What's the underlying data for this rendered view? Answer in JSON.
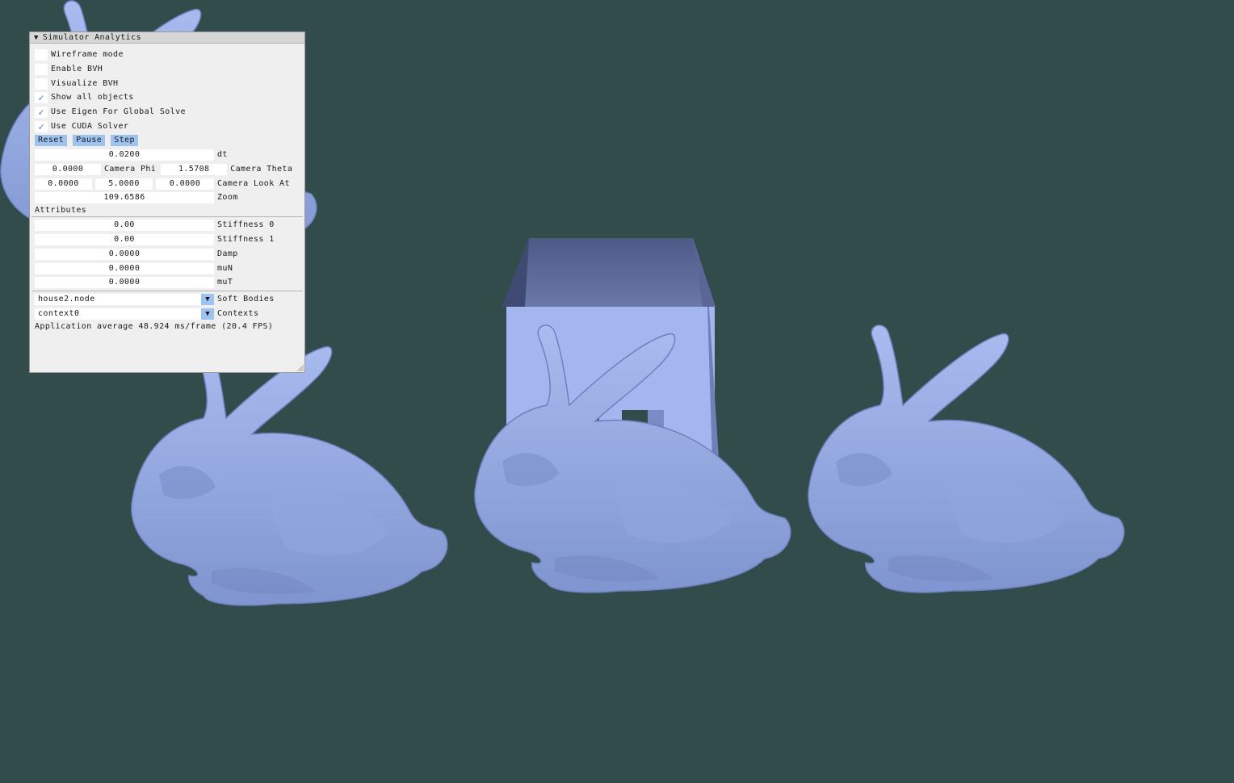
{
  "panel": {
    "title": "Simulator Analytics",
    "collapse_icon": "triangle-down-icon",
    "checkboxes": [
      {
        "label": "Wireframe mode",
        "checked": false
      },
      {
        "label": "Enable BVH",
        "checked": false
      },
      {
        "label": "Visualize BVH",
        "checked": false
      },
      {
        "label": "Show all objects",
        "checked": true
      },
      {
        "label": "Use Eigen For Global Solve",
        "checked": true
      },
      {
        "label": "Use CUDA Solver",
        "checked": true
      }
    ],
    "buttons": {
      "reset": "Reset",
      "pause": "Pause",
      "step": "Step"
    },
    "dt": {
      "value": "0.0200",
      "label": "dt"
    },
    "camera_phi": {
      "value": "0.0000",
      "label": "Camera Phi"
    },
    "camera_theta": {
      "value": "1.5708",
      "label": "Camera Theta"
    },
    "camera_look_at": {
      "x": "0.0000",
      "y": "5.0000",
      "z": "0.0000",
      "label": "Camera Look At"
    },
    "zoom": {
      "value": "109.6586",
      "label": "Zoom"
    },
    "attributes_header": "Attributes",
    "stiffness0": {
      "value": "0.00",
      "label": "Stiffness 0"
    },
    "stiffness1": {
      "value": "0.00",
      "label": "Stiffness 1"
    },
    "damp": {
      "value": "0.0000",
      "label": "Damp"
    },
    "mun": {
      "value": "0.0000",
      "label": "muN"
    },
    "mut": {
      "value": "0.0000",
      "label": "muT"
    },
    "soft_bodies": {
      "selected": "house2.node",
      "label": "Soft Bodies"
    },
    "contexts": {
      "selected": "context0",
      "label": "Contexts"
    },
    "status": "Application average 48.924 ms/frame (20.4 FPS)"
  },
  "scene": {
    "background": "#324b4b",
    "object_color": "#8fa6e0",
    "objects": [
      "bunny",
      "house",
      "bunny",
      "bunny"
    ]
  }
}
